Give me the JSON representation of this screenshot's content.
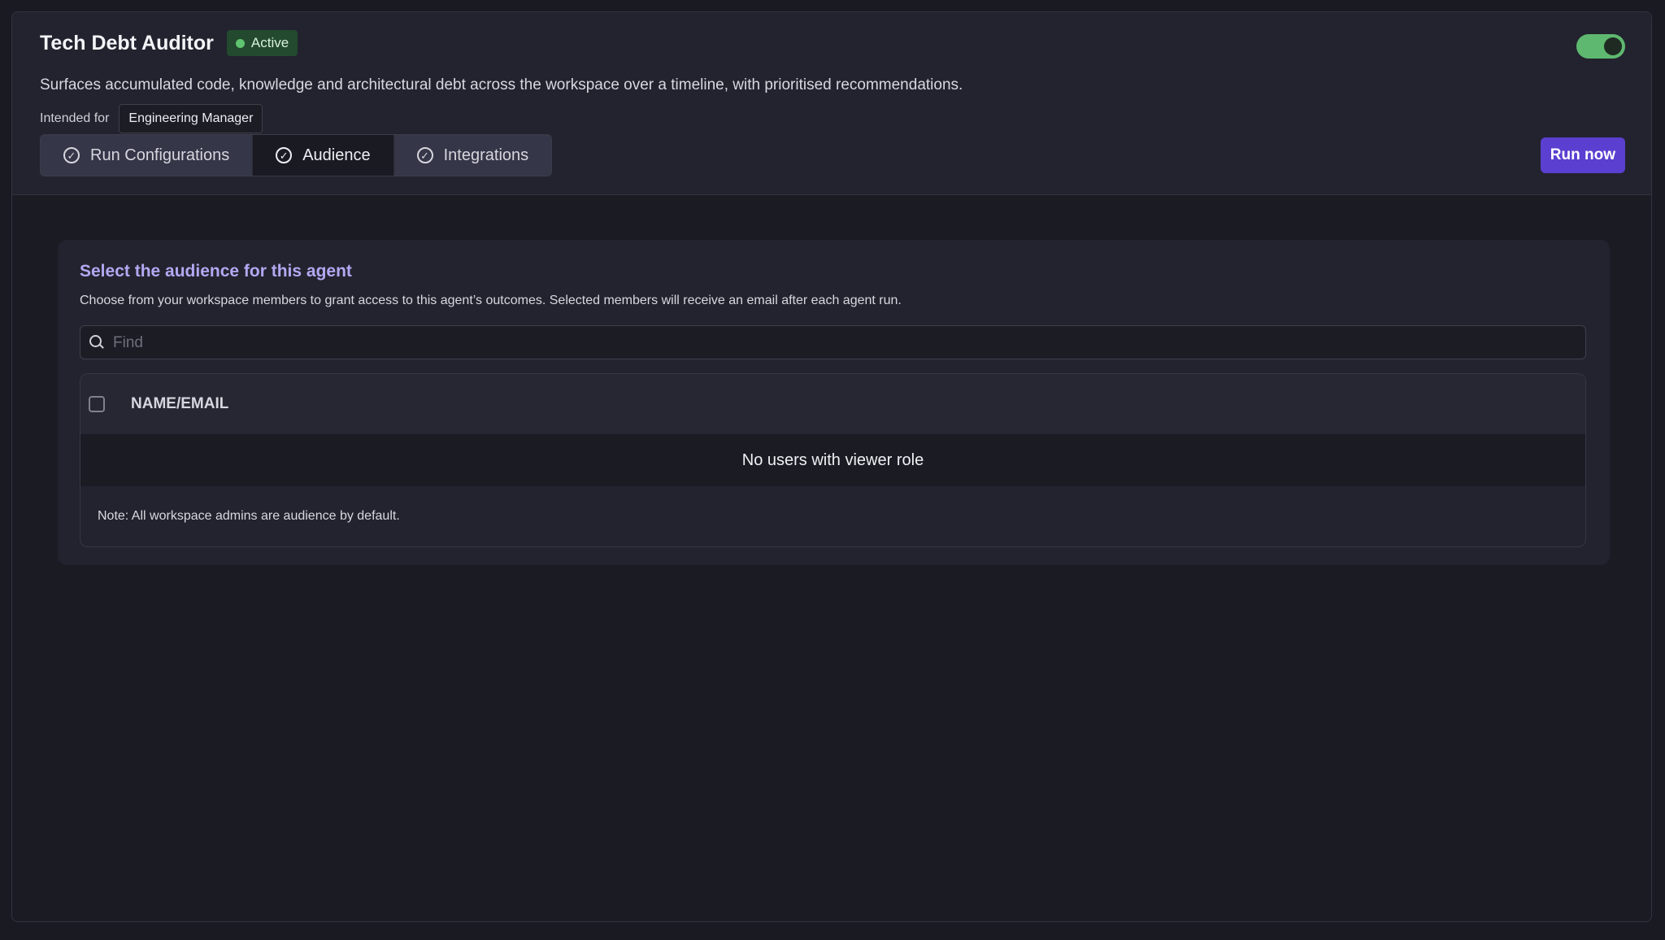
{
  "agent": {
    "title": "Tech Debt Auditor",
    "status": "Active",
    "description": "Surfaces accumulated code, knowledge and architectural debt across the workspace over a timeline, with prioritised recommendations.",
    "intended_for_label": "Intended for",
    "intended_role": "Engineering Manager",
    "enabled": true
  },
  "tabs": [
    {
      "label": "Run Configurations",
      "active": false
    },
    {
      "label": "Audience",
      "active": true
    },
    {
      "label": "Integrations",
      "active": false
    }
  ],
  "actions": {
    "run_now": "Run now"
  },
  "audience": {
    "title": "Select the audience for this agent",
    "subtitle": "Choose from your workspace members to grant access to this agent’s outcomes. Selected members will receive an email after each agent run.",
    "search_placeholder": "Find",
    "column_header": "NAME/EMAIL",
    "empty_message": "No users with viewer role",
    "note": "Note: All workspace admins are audience by default."
  },
  "colors": {
    "accent": "#5a3fd0",
    "accent_text": "#b3a8f2",
    "active_green": "#5fc46f"
  },
  "icons": {
    "tab": "check-circle-icon",
    "search": "search-icon"
  }
}
